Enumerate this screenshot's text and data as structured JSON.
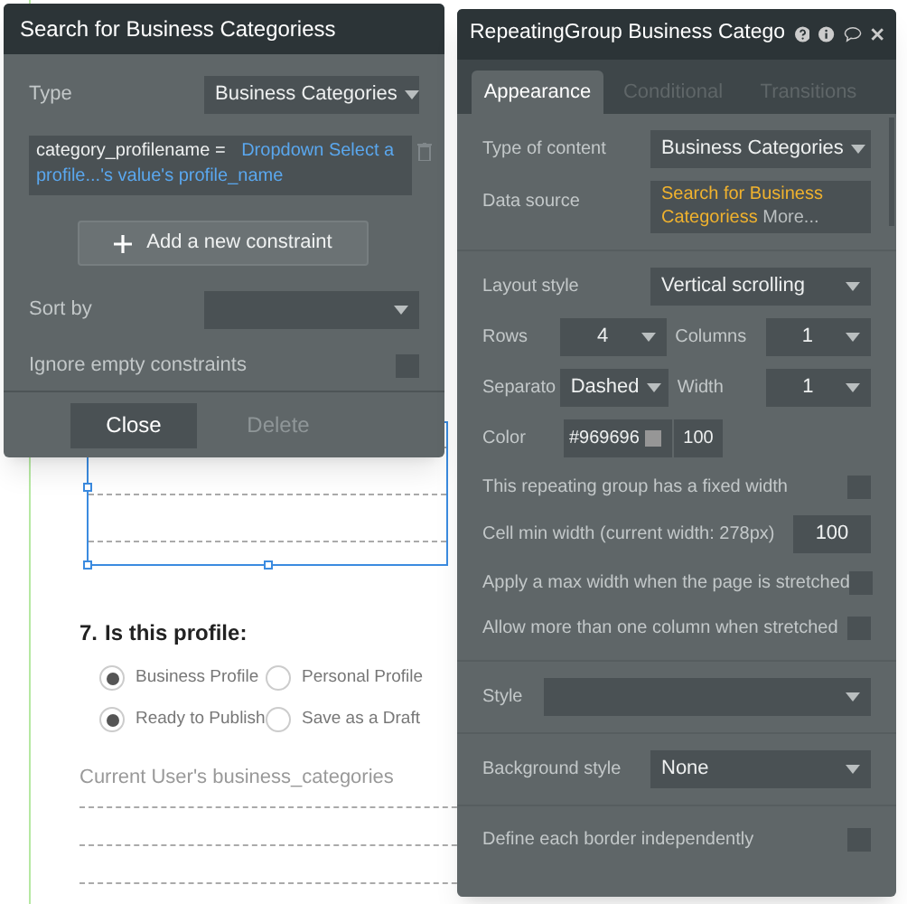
{
  "background_page": {
    "question": {
      "number": "7.",
      "text": "Is this profile:"
    },
    "radio_groups": [
      [
        {
          "label": "Business Profile",
          "selected": true
        },
        {
          "label": "Personal Profile",
          "selected": false
        }
      ],
      [
        {
          "label": "Ready to Publish",
          "selected": true
        },
        {
          "label": "Save as a Draft",
          "selected": false
        }
      ]
    ],
    "list_label": "Current User's business_categories"
  },
  "search_panel": {
    "title": "Search for Business Categoriess",
    "type": {
      "label": "Type",
      "value": "Business Categories"
    },
    "constraint": {
      "field": "category_profilename =",
      "value": "Dropdown Select a profile...'s value's profile_name"
    },
    "add_button": "Add a new constraint",
    "sort_by": {
      "label": "Sort by"
    },
    "ignore_empty": {
      "label": "Ignore empty constraints",
      "checked": false
    },
    "buttons": [
      {
        "label": "Close",
        "disabled": false
      },
      {
        "label": "Delete",
        "disabled": true
      }
    ]
  },
  "property_panel": {
    "title": "RepeatingGroup Business Catego",
    "tabs": [
      {
        "label": "Appearance",
        "selected": true
      },
      {
        "label": "Conditional",
        "selected": false
      },
      {
        "label": "Transitions",
        "selected": false
      }
    ],
    "sections": [
      [
        {
          "kind": "dropdown",
          "label": "Type of content",
          "value": "Business Categories"
        },
        {
          "kind": "source",
          "label": "Data source",
          "value": "Search for Business Categoriess",
          "more": "More..."
        }
      ],
      [
        {
          "kind": "dropdown",
          "label": "Layout style",
          "value": "Vertical scrolling"
        },
        {
          "kind": "pair",
          "label": "Rows",
          "value": "4",
          "label2": "Columns",
          "value2": "1"
        },
        {
          "kind": "pair",
          "label": "Separato",
          "value": "Dashed",
          "label2": "Width",
          "value2": "1"
        },
        {
          "kind": "color",
          "label": "Color",
          "value": "#969696",
          "opacity": "100"
        },
        {
          "kind": "checkbox",
          "label": "This repeating group has a fixed width",
          "checked": false
        },
        {
          "kind": "number",
          "label": "Cell min width (current width: 278px)",
          "value": "100"
        },
        {
          "kind": "checkbox",
          "label": "Apply a max width when the page is stretched",
          "checked": false
        },
        {
          "kind": "checkbox",
          "label": "Allow more than one column when stretched",
          "checked": false
        }
      ],
      [
        {
          "kind": "wide",
          "label": "Style"
        }
      ],
      [
        {
          "kind": "dropdown",
          "label": "Background style",
          "value": "None"
        }
      ],
      [
        {
          "kind": "checkbox",
          "label": "Define each border independently",
          "checked": false
        }
      ]
    ]
  }
}
